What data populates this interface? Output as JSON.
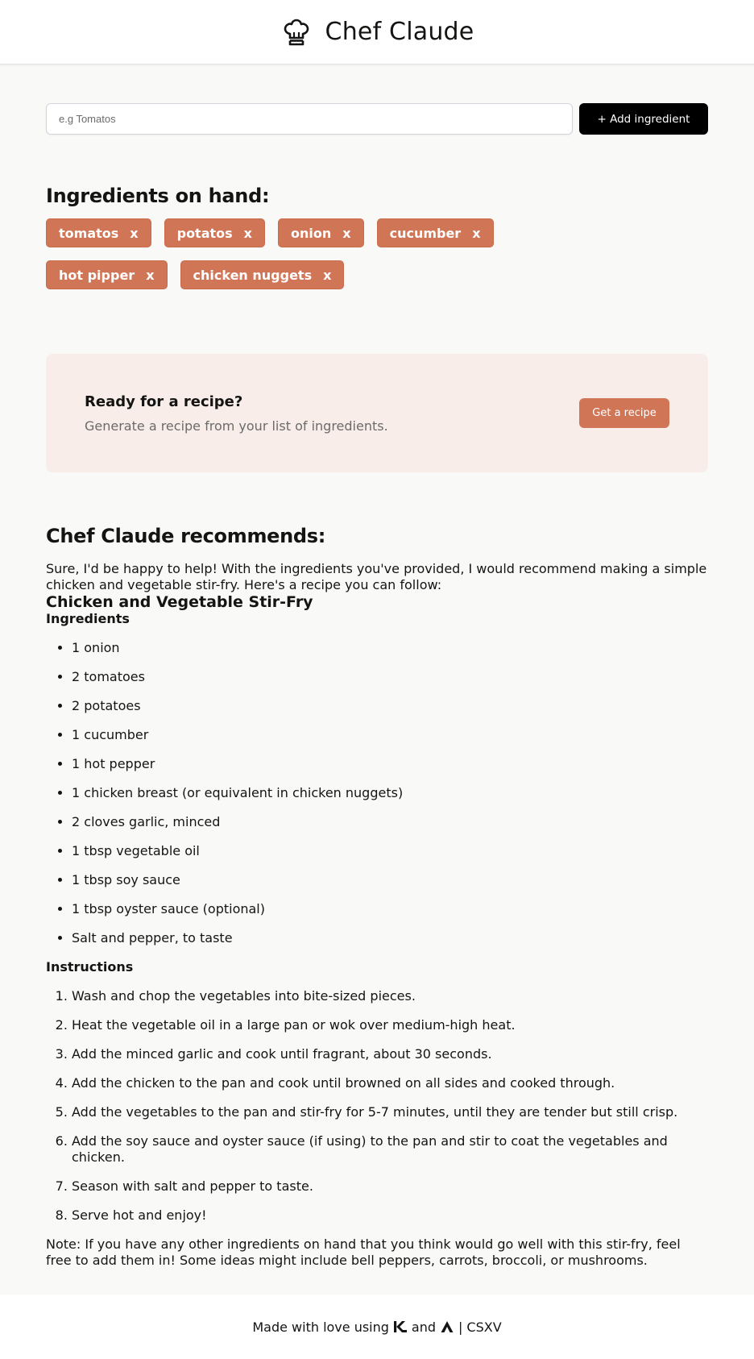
{
  "header": {
    "title": "Chef Claude",
    "logo_icon": "chef-hat-icon"
  },
  "add_form": {
    "placeholder": "e.g Tomatos",
    "value": "",
    "button_label": "+ Add ingredient"
  },
  "ingredients": {
    "heading": "Ingredients on hand:",
    "remove_glyph": "x",
    "items": [
      "tomatos",
      "potatos",
      "onion",
      "cucumber",
      "hot pipper",
      "chicken nuggets"
    ]
  },
  "cta": {
    "title": "Ready for a recipe?",
    "subtitle": "Generate a recipe from your list of ingredients.",
    "button_label": "Get a recipe"
  },
  "recipe": {
    "heading": "Chef Claude recommends:",
    "intro": "Sure, I'd be happy to help! With the ingredients you've provided, I would recommend making a simple chicken and vegetable stir-fry. Here's a recipe you can follow:",
    "dish_title": "Chicken and Vegetable Stir-Fry",
    "ingredients_heading": "Ingredients",
    "ingredients": [
      "1 onion",
      "2 tomatoes",
      "2 potatoes",
      "1 cucumber",
      "1 hot pepper",
      "1 chicken breast (or equivalent in chicken nuggets)",
      "2 cloves garlic, minced",
      "1 tbsp vegetable oil",
      "1 tbsp soy sauce",
      "1 tbsp oyster sauce (optional)",
      "Salt and pepper, to taste"
    ],
    "instructions_heading": "Instructions",
    "instructions": [
      "Wash and chop the vegetables into bite-sized pieces.",
      "Heat the vegetable oil in a large pan or wok over medium-high heat.",
      "Add the minced garlic and cook until fragrant, about 30 seconds.",
      "Add the chicken to the pan and cook until browned on all sides and cooked through.",
      "Add the vegetables to the pan and stir-fry for 5-7 minutes, until they are tender but still crisp.",
      "Add the soy sauce and oyster sauce (if using) to the pan and stir to coat the vegetables and chicken.",
      "Season with salt and pepper to taste.",
      "Serve hot and enjoy!"
    ],
    "note": "Note: If you have any other ingredients on hand that you think would go well with this stir-fry, feel free to add them in! Some ideas might include bell peppers, carrots, broccoli, or mushrooms."
  },
  "footer": {
    "made_with": "Made with love using",
    "and": "and",
    "separator": "|",
    "author": "CSXV",
    "icon_1": "framework-k-icon",
    "icon_2": "framework-a-icon"
  },
  "colors": {
    "accent": "#d17557",
    "cta_bg": "#f8ede8",
    "page_bg": "#f9f9f7",
    "button_dark": "#000000"
  }
}
